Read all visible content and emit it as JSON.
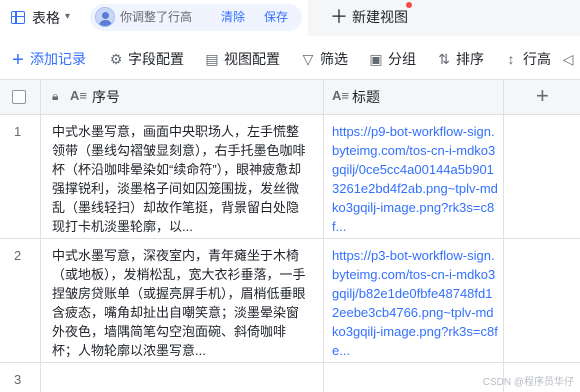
{
  "view_tab": {
    "icon": "grid-table-icon",
    "label": "表格",
    "caret": "▾"
  },
  "notice": {
    "message": "你调整了行高",
    "clear_label": "清除",
    "save_label": "保存"
  },
  "new_view": {
    "label": "新建视图"
  },
  "toolbar": {
    "add_record": "添加记录",
    "field_config": "字段配置",
    "view_config": "视图配置",
    "filter": "筛选",
    "group": "分组",
    "sort": "排序",
    "row_height": "行高"
  },
  "columns": [
    {
      "type_icon": "A≡",
      "label": "序号",
      "locked": true
    },
    {
      "type_icon": "A≡",
      "label": "标题",
      "locked": false
    }
  ],
  "rows": [
    {
      "index": "1",
      "text": "中式水墨写意，画面中央职场人，左手慌整领带（墨线勾褶皱显刻意），右手托墨色咖啡杯（杯沿咖啡晕染如“续命符”），眼神疲惫却强撑锐利，淡墨格子间如囚笼围拢，发丝微乱（墨线轻扫）却故作笔挺，背景留白处隐现打卡机淡墨轮廓，以...",
      "link": "https://p9-bot-workflow-sign.byteimg.com/tos-cn-i-mdko3gqilj/0ce5cc4a00144a5b9013261e2bd4f2ab.png~tplv-mdko3gqilj-image.png?rk3s=c8f..."
    },
    {
      "index": "2",
      "text": "中式水墨写意，深夜室内，青年瘫坐于木椅（或地板），发梢松乱，宽大衣衫垂落，一手捏皱房贷账单（或握亮屏手机），眉梢低垂眼含疲态，嘴角却扯出自嘲笑意；淡墨晕染窗外夜色，墙隅简笔勾空泡面碗、斜倚咖啡杯；人物轮廓以浓墨写意...",
      "link": "https://p3-bot-workflow-sign.byteimg.com/tos-cn-i-mdko3gqilj/b82e1de0fbfe48748fd12eebe3cb4766.png~tplv-mdko3gqilj-image.png?rk3s=c8fe..."
    },
    {
      "index": "3",
      "text": "",
      "link": ""
    }
  ],
  "watermark": "CSDN @程序员华仔",
  "colors": {
    "accent": "#3370ff",
    "border": "#dee0e3",
    "header_bg": "#f5f6f7",
    "notice_bg": "#f0f4ff",
    "dot": "#f54a45"
  }
}
